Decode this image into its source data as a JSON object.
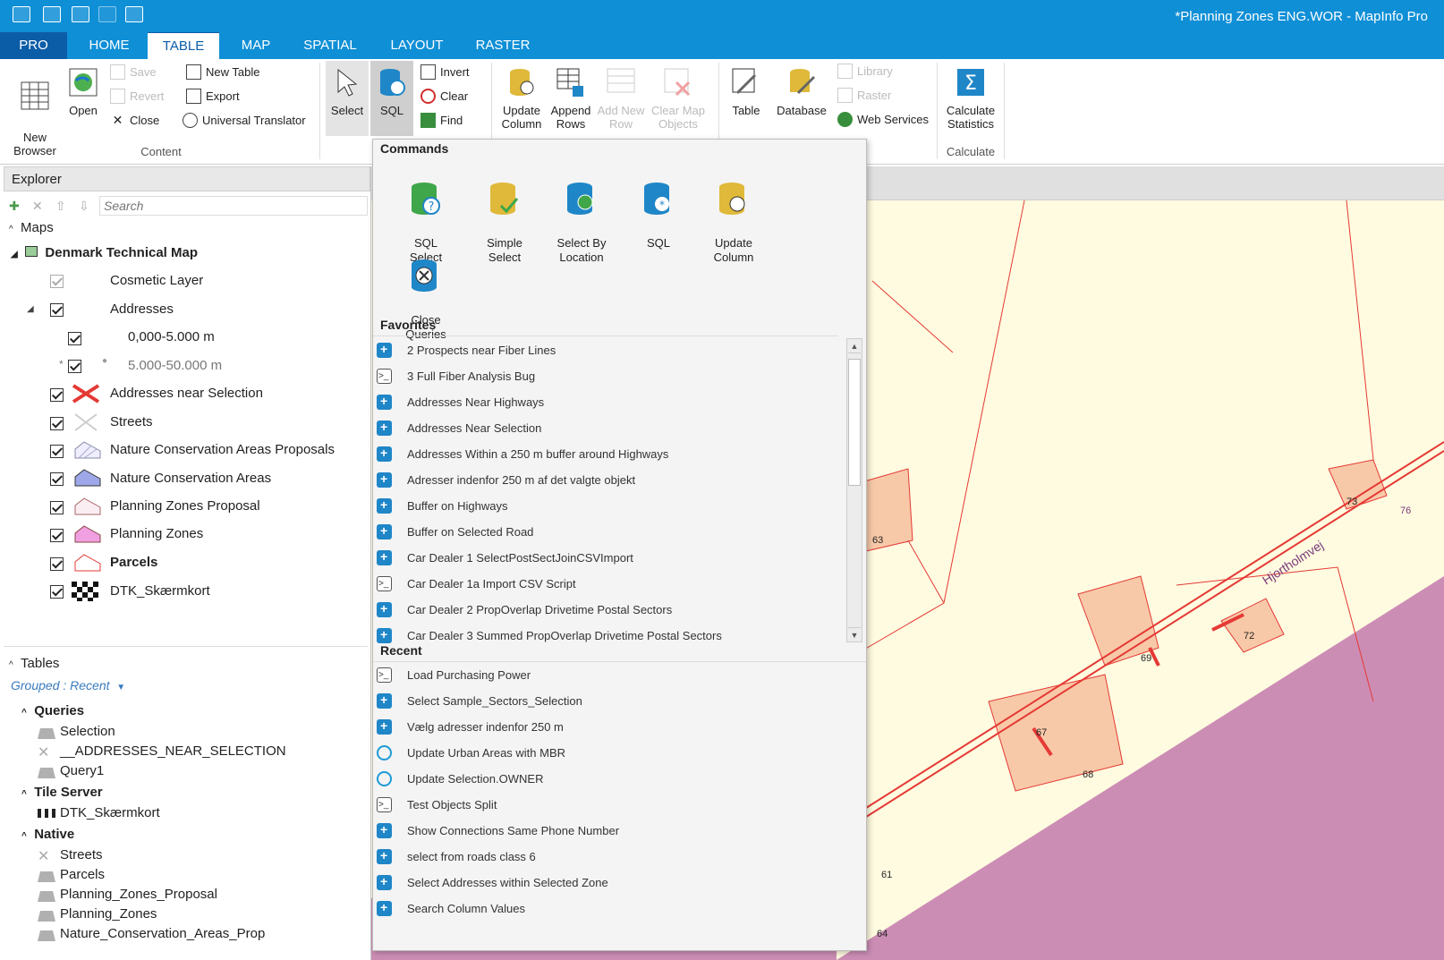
{
  "window": {
    "title": "*Planning Zones ENG.WOR - MapInfo Pro"
  },
  "tabs": [
    {
      "label": "PRO"
    },
    {
      "label": "HOME"
    },
    {
      "label": "TABLE"
    },
    {
      "label": "MAP"
    },
    {
      "label": "SPATIAL"
    },
    {
      "label": "LAYOUT"
    },
    {
      "label": "RASTER"
    }
  ],
  "ribbon": {
    "content": {
      "new_browser": "New\nBrowser",
      "open": "Open",
      "save": "Save",
      "revert": "Revert",
      "close": "Close",
      "new_table": "New Table",
      "export": "Export",
      "universal_translator": "Universal Translator",
      "group": "Content"
    },
    "select": "Select",
    "sql": "SQL",
    "invert": "Invert",
    "clear": "Clear",
    "find": "Find",
    "update_column": "Update Column",
    "append_rows": "Append Rows",
    "add_new_row": "Add New Row",
    "clear_map_objects": "Clear Map Objects",
    "table": "Table",
    "database": "Database",
    "library": "Library",
    "raster": "Raster",
    "web_services": "Web Services",
    "calc_stats": "Calculate Statistics",
    "calc_group": "Calculate"
  },
  "explorer": {
    "title": "Explorer",
    "search_placeholder": "Search",
    "maps_label": "Maps",
    "map_name": "Denmark Technical Map",
    "layers": [
      {
        "label": "Cosmetic Layer"
      },
      {
        "label": "Addresses"
      },
      {
        "label": "0,000-5.000 m"
      },
      {
        "label": "5.000-50.000 m"
      },
      {
        "label": "Addresses near Selection"
      },
      {
        "label": "Streets"
      },
      {
        "label": "Nature Conservation Areas Proposals"
      },
      {
        "label": "Nature Conservation Areas"
      },
      {
        "label": "Planning Zones Proposal"
      },
      {
        "label": "Planning Zones"
      },
      {
        "label": "Parcels"
      },
      {
        "label": "DTK_Skærmkort"
      }
    ],
    "tables_label": "Tables",
    "grouped": "Grouped : Recent",
    "queries_label": "Queries",
    "queries": [
      "Selection",
      "__ADDRESSES_NEAR_SELECTION",
      "Query1"
    ],
    "tile_label": "Tile Server",
    "tile": [
      "DTK_Skærmkort"
    ],
    "native_label": "Native",
    "native": [
      "Streets",
      "Parcels",
      "Planning_Zones_Proposal",
      "Planning_Zones",
      "Nature_Conservation_Areas_Prop"
    ]
  },
  "dropdown": {
    "commands_label": "Commands",
    "commands": [
      {
        "label": "SQL\nSelect"
      },
      {
        "label": "Simple\nSelect"
      },
      {
        "label": "Select By\nLocation"
      },
      {
        "label": "SQL"
      },
      {
        "label": "Update\nColumn"
      },
      {
        "label": "Close\nQueries"
      }
    ],
    "favorites_label": "Favorites",
    "favorites": [
      {
        "label": "2 Prospects near Fiber Lines",
        "icon": "sql"
      },
      {
        "label": "3 Full Fiber Analysis Bug",
        "icon": "script"
      },
      {
        "label": "Addresses Near Highways",
        "icon": "sql"
      },
      {
        "label": "Addresses Near Selection",
        "icon": "sql"
      },
      {
        "label": "Addresses Within a 250 m buffer around Highways",
        "icon": "sql"
      },
      {
        "label": "Adresser indenfor 250 m af det valgte objekt",
        "icon": "sql"
      },
      {
        "label": "Buffer on Highways",
        "icon": "sql"
      },
      {
        "label": "Buffer on Selected Road",
        "icon": "sql"
      },
      {
        "label": "Car Dealer 1 SelectPostSectJoinCSVImport",
        "icon": "sql"
      },
      {
        "label": "Car Dealer 1a Import CSV Script",
        "icon": "script"
      },
      {
        "label": "Car Dealer 2 PropOverlap Drivetime Postal Sectors",
        "icon": "sql"
      },
      {
        "label": "Car Dealer 3 Summed PropOverlap Drivetime Postal Sectors",
        "icon": "sql"
      }
    ],
    "recent_label": "Recent",
    "recent": [
      {
        "label": "Load Purchasing Power",
        "icon": "script"
      },
      {
        "label": "Select Sample_Sectors_Selection",
        "icon": "sql"
      },
      {
        "label": "Vælg adresser indenfor 250 m",
        "icon": "sql"
      },
      {
        "label": "Update Urban Areas with MBR",
        "icon": "update"
      },
      {
        "label": "Update Selection.OWNER",
        "icon": "update"
      },
      {
        "label": "Test Objects Split",
        "icon": "script"
      },
      {
        "label": "Show Connections Same Phone Number",
        "icon": "sql"
      },
      {
        "label": "select from roads class 6",
        "icon": "sql"
      },
      {
        "label": "Select Addresses within Selected Zone",
        "icon": "sql"
      },
      {
        "label": "Search Column Values",
        "icon": "sql"
      }
    ]
  },
  "map": {
    "labels": [
      "73",
      "76",
      "69",
      "72",
      "67",
      "68",
      "63",
      "61",
      "64"
    ],
    "road_label": "Hjortholmvej"
  }
}
